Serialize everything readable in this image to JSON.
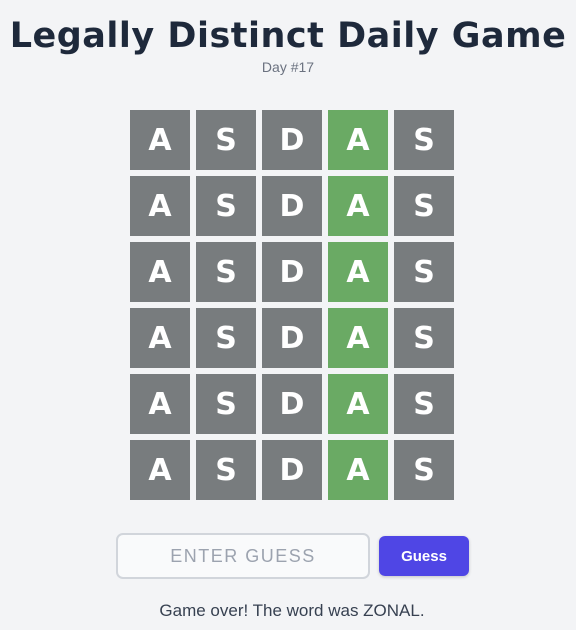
{
  "header": {
    "title": "Legally Distinct Daily Game",
    "subtitle": "Day #17"
  },
  "board": {
    "rows": [
      [
        {
          "letter": "A",
          "state": "absent"
        },
        {
          "letter": "S",
          "state": "absent"
        },
        {
          "letter": "D",
          "state": "absent"
        },
        {
          "letter": "A",
          "state": "correct"
        },
        {
          "letter": "S",
          "state": "absent"
        }
      ],
      [
        {
          "letter": "A",
          "state": "absent"
        },
        {
          "letter": "S",
          "state": "absent"
        },
        {
          "letter": "D",
          "state": "absent"
        },
        {
          "letter": "A",
          "state": "correct"
        },
        {
          "letter": "S",
          "state": "absent"
        }
      ],
      [
        {
          "letter": "A",
          "state": "absent"
        },
        {
          "letter": "S",
          "state": "absent"
        },
        {
          "letter": "D",
          "state": "absent"
        },
        {
          "letter": "A",
          "state": "correct"
        },
        {
          "letter": "S",
          "state": "absent"
        }
      ],
      [
        {
          "letter": "A",
          "state": "absent"
        },
        {
          "letter": "S",
          "state": "absent"
        },
        {
          "letter": "D",
          "state": "absent"
        },
        {
          "letter": "A",
          "state": "correct"
        },
        {
          "letter": "S",
          "state": "absent"
        }
      ],
      [
        {
          "letter": "A",
          "state": "absent"
        },
        {
          "letter": "S",
          "state": "absent"
        },
        {
          "letter": "D",
          "state": "absent"
        },
        {
          "letter": "A",
          "state": "correct"
        },
        {
          "letter": "S",
          "state": "absent"
        }
      ],
      [
        {
          "letter": "A",
          "state": "absent"
        },
        {
          "letter": "S",
          "state": "absent"
        },
        {
          "letter": "D",
          "state": "absent"
        },
        {
          "letter": "A",
          "state": "correct"
        },
        {
          "letter": "S",
          "state": "absent"
        }
      ]
    ]
  },
  "input": {
    "value": "",
    "placeholder": "ENTER GUESS"
  },
  "guess_button": {
    "label": "Guess"
  },
  "status": {
    "message": "Game over! The word was ZONAL."
  },
  "colors": {
    "absent": "#787c7e",
    "correct": "#6aaa64",
    "present": "#c9b458",
    "button": "#4f46e5",
    "title": "#1e293b"
  }
}
